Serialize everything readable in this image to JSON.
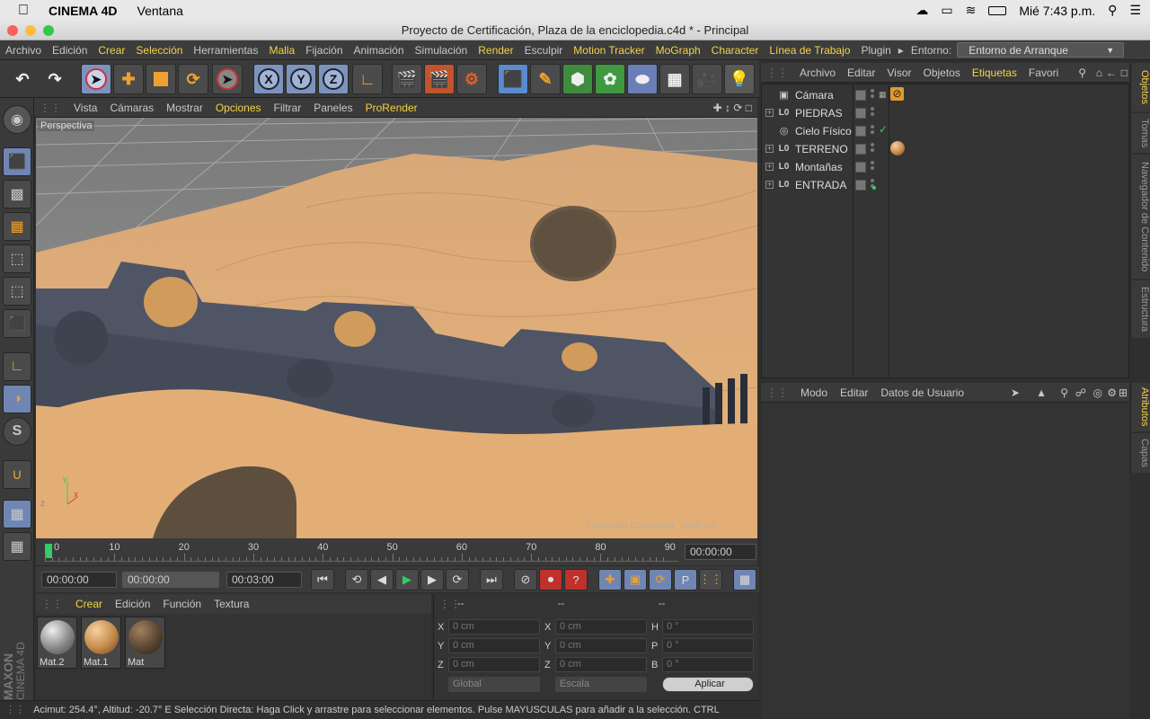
{
  "macos": {
    "app_name": "CINEMA 4D",
    "menu_window": "Ventana",
    "clock": "Mié 7:43 p.m."
  },
  "window": {
    "title": "Proyecto de Certificación, Plaza de la enciclopedia.c4d * - Principal"
  },
  "menu": {
    "items": [
      {
        "label": "Archivo",
        "hl": false
      },
      {
        "label": "Edición",
        "hl": false
      },
      {
        "label": "Crear",
        "hl": true
      },
      {
        "label": "Selección",
        "hl": true
      },
      {
        "label": "Herramientas",
        "hl": false
      },
      {
        "label": "Malla",
        "hl": true
      },
      {
        "label": "Fijación",
        "hl": false
      },
      {
        "label": "Animación",
        "hl": false
      },
      {
        "label": "Simulación",
        "hl": false
      },
      {
        "label": "Render",
        "hl": true
      },
      {
        "label": "Esculpir",
        "hl": false
      },
      {
        "label": "Motion Tracker",
        "hl": true
      },
      {
        "label": "MoGraph",
        "hl": true
      },
      {
        "label": "Character",
        "hl": true
      },
      {
        "label": "Línea de Trabajo",
        "hl": true
      },
      {
        "label": "Plugin",
        "hl": false
      }
    ],
    "env_label": "Entorno:",
    "env_value": "Entorno de Arranque"
  },
  "toolbar": {
    "x_label": "X",
    "y_label": "Y",
    "z_label": "Z"
  },
  "viewport": {
    "menu": [
      {
        "label": "Vista",
        "hl": false
      },
      {
        "label": "Cámaras",
        "hl": false
      },
      {
        "label": "Mostrar",
        "hl": false
      },
      {
        "label": "Opciones",
        "hl": true
      },
      {
        "label": "Filtrar",
        "hl": false
      },
      {
        "label": "Paneles",
        "hl": false
      },
      {
        "label": "ProRender",
        "hl": true
      }
    ],
    "camera_label": "Perspectiva",
    "grid_info": "Espaciado Cuadrícula : 1000 cm"
  },
  "timeline": {
    "ticks": [
      "0",
      "10",
      "20",
      "30",
      "40",
      "50",
      "60",
      "70",
      "80",
      "90"
    ],
    "current_frame_field": "00:00:00"
  },
  "playback": {
    "start": "00:00:00",
    "min_field": "00:00:00",
    "end": "00:03:00"
  },
  "materials": {
    "menu": [
      {
        "label": "Crear",
        "hl": true
      },
      {
        "label": "Edición",
        "hl": false
      },
      {
        "label": "Función",
        "hl": false
      },
      {
        "label": "Textura",
        "hl": false
      }
    ],
    "items": [
      {
        "name": "Mat.2"
      },
      {
        "name": "Mat.1"
      },
      {
        "name": "Mat"
      }
    ],
    "brand_line1": "MAXON",
    "brand_line2": "CINEMA 4D"
  },
  "coords": {
    "headers": [
      "--",
      "--",
      "--"
    ],
    "pos_labels": [
      "X",
      "Y",
      "Z"
    ],
    "scale_labels": [
      "X",
      "Y",
      "Z"
    ],
    "rot_labels": [
      "H",
      "P",
      "B"
    ],
    "pos_values": [
      "0 cm",
      "0 cm",
      "0 cm"
    ],
    "scale_values": [
      "0 cm",
      "0 cm",
      "0 cm"
    ],
    "rot_values": [
      "0 °",
      "0 °",
      "0 °"
    ],
    "mode1": "Global",
    "mode2": "Escala",
    "apply": "Aplicar"
  },
  "status_text": "Acimut: 254.4°, Altitud: -20.7°  E     Selección Directa: Haga Click y arrastre para seleccionar elementos. Pulse MAYUSCULAS para añadir a la selección. CTRL",
  "objects": {
    "menu": [
      {
        "label": "Archivo",
        "hl": false
      },
      {
        "label": "Editar",
        "hl": false
      },
      {
        "label": "Visor",
        "hl": false
      },
      {
        "label": "Objetos",
        "hl": false
      },
      {
        "label": "Etiquetas",
        "hl": true
      },
      {
        "label": "Favori",
        "hl": false
      }
    ],
    "rows": [
      {
        "name": "Cámara",
        "expand": false,
        "icon": "camera-icon"
      },
      {
        "name": "PIEDRAS",
        "expand": true,
        "icon": "null-icon"
      },
      {
        "name": "Cielo Físico",
        "expand": false,
        "icon": "sky-icon"
      },
      {
        "name": "TERRENO",
        "expand": true,
        "icon": "null-icon"
      },
      {
        "name": "Montañas",
        "expand": true,
        "icon": "null-icon"
      },
      {
        "name": "ENTRADA",
        "expand": true,
        "icon": "null-icon"
      }
    ]
  },
  "attributes": {
    "menu": [
      "Modo",
      "Editar",
      "Datos de Usuario"
    ]
  },
  "side_tabs": {
    "objects": "Objetos",
    "takes": "Tomas",
    "browser": "Navegador de Contenido",
    "structure": "Estructura",
    "attributes": "Atributos",
    "layers": "Capas"
  }
}
